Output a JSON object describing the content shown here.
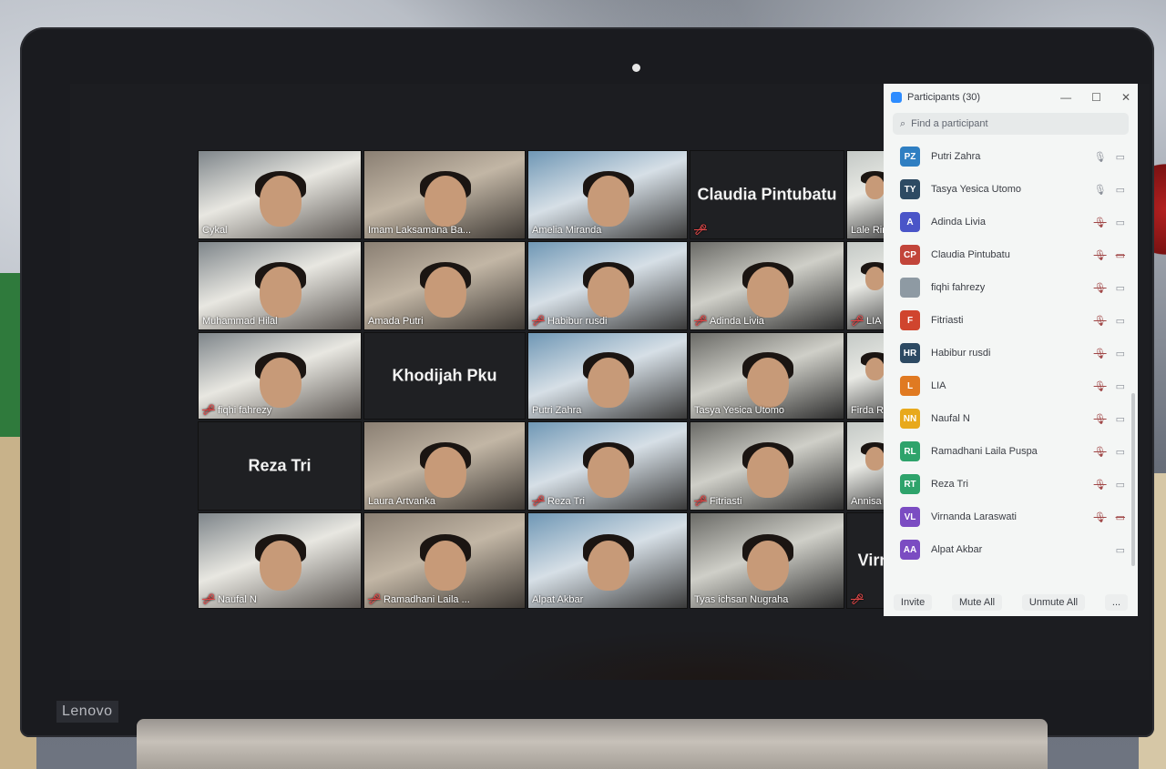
{
  "device": {
    "brand": "Lenovo"
  },
  "grid": {
    "tiles": [
      {
        "name": "Cykal",
        "muted": false,
        "video": true
      },
      {
        "name": "Imam Laksamana Ba...",
        "muted": false,
        "video": true
      },
      {
        "name": "Amelia Miranda",
        "muted": false,
        "video": true
      },
      {
        "name": "Claudia Pintubatu",
        "muted": true,
        "video": false
      },
      {
        "name": "Lale Rinu",
        "muted": false,
        "video": true
      },
      {
        "name": "Muhammad Hilal",
        "muted": false,
        "video": true
      },
      {
        "name": "Amada Putri",
        "muted": false,
        "video": true
      },
      {
        "name": "Habibur rusdi",
        "muted": true,
        "video": true
      },
      {
        "name": "Adinda Livia",
        "muted": true,
        "video": true
      },
      {
        "name": "LIA",
        "muted": true,
        "video": true
      },
      {
        "name": "fiqhi fahrezy",
        "muted": true,
        "video": true
      },
      {
        "name": "Khodijah Pku",
        "muted": false,
        "video": false
      },
      {
        "name": "Putri Zahra",
        "muted": false,
        "video": true
      },
      {
        "name": "Tasya Yesica Utomo",
        "muted": false,
        "video": true
      },
      {
        "name": "Firda Roz",
        "muted": false,
        "video": true
      },
      {
        "name": "Reza Tri",
        "muted": false,
        "video": false
      },
      {
        "name": "Laura Artvanka",
        "muted": false,
        "video": true
      },
      {
        "name": "Reza Tri",
        "muted": true,
        "video": true
      },
      {
        "name": "Fitriasti",
        "muted": true,
        "video": true
      },
      {
        "name": "Annisa N",
        "muted": false,
        "video": true
      },
      {
        "name": "Naufal N",
        "muted": true,
        "video": true
      },
      {
        "name": "Ramadhani Laila ...",
        "muted": true,
        "video": true
      },
      {
        "name": "Alpat Akbar",
        "muted": false,
        "video": true
      },
      {
        "name": "Tyas ichsan Nugraha",
        "muted": false,
        "video": true
      },
      {
        "name": "Virn",
        "muted": true,
        "video": false
      }
    ]
  },
  "participants": {
    "title": "Participants (30)",
    "search_placeholder": "Find a participant",
    "list": [
      {
        "initials": "PZ",
        "name": "Putri Zahra",
        "color": "#2f7fc2",
        "mic": "on",
        "cam": "on"
      },
      {
        "initials": "TY",
        "name": "Tasya Yesica Utomo",
        "color": "#2d4a63",
        "mic": "on",
        "cam": "on"
      },
      {
        "initials": "A",
        "name": "Adinda Livia",
        "color": "#4a55c8",
        "mic": "off",
        "cam": "on"
      },
      {
        "initials": "CP",
        "name": "Claudia Pintubatu",
        "color": "#c2453a",
        "mic": "off",
        "cam": "off"
      },
      {
        "initials": "",
        "name": "fiqhi fahrezy",
        "color": "#8e9aa3",
        "mic": "off",
        "cam": "on"
      },
      {
        "initials": "F",
        "name": "Fitriasti",
        "color": "#d0452e",
        "mic": "off",
        "cam": "on"
      },
      {
        "initials": "HR",
        "name": "Habibur rusdi",
        "color": "#2d4a63",
        "mic": "off",
        "cam": "on"
      },
      {
        "initials": "L",
        "name": "LIA",
        "color": "#e07a22",
        "mic": "off",
        "cam": "on"
      },
      {
        "initials": "NN",
        "name": "Naufal N",
        "color": "#e8a91c",
        "mic": "off",
        "cam": "on"
      },
      {
        "initials": "RL",
        "name": "Ramadhani Laila Puspa",
        "color": "#2ea36b",
        "mic": "off",
        "cam": "on"
      },
      {
        "initials": "RT",
        "name": "Reza Tri",
        "color": "#2ea36b",
        "mic": "off",
        "cam": "on"
      },
      {
        "initials": "VL",
        "name": "Virnanda Laraswati",
        "color": "#7b4cc2",
        "mic": "off",
        "cam": "off"
      },
      {
        "initials": "AA",
        "name": "Alpat Akbar",
        "color": "#7b4cc2",
        "mic": "none",
        "cam": "on"
      }
    ],
    "footer": {
      "invite": "Invite",
      "mute_all": "Mute All",
      "unmute_all": "Unmute All",
      "more": "..."
    }
  }
}
